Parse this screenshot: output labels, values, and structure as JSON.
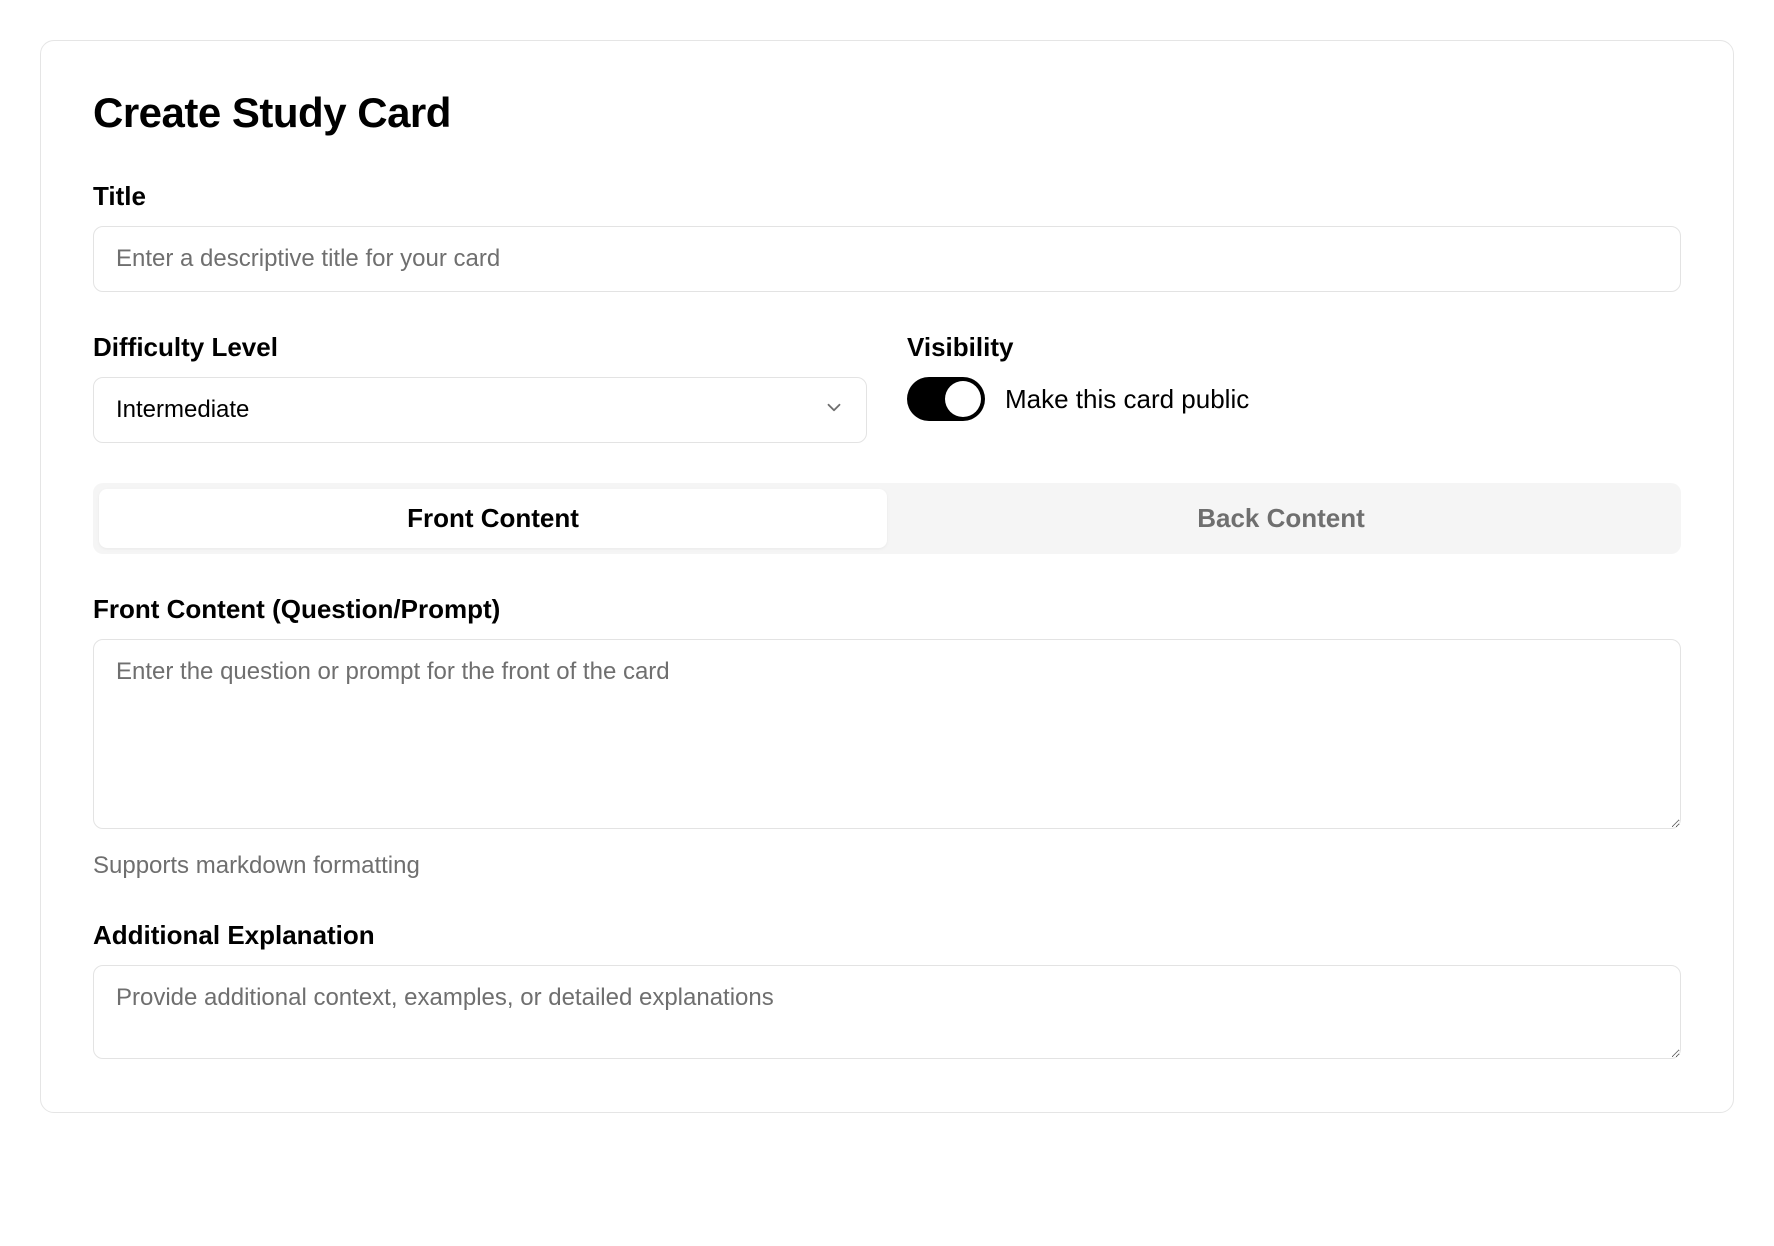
{
  "header": {
    "title": "Create Study Card"
  },
  "fields": {
    "title": {
      "label": "Title",
      "placeholder": "Enter a descriptive title for your card",
      "value": ""
    },
    "difficulty": {
      "label": "Difficulty Level",
      "selected": "Intermediate"
    },
    "visibility": {
      "label": "Visibility",
      "toggle_label": "Make this card public",
      "enabled": true
    },
    "tabs": {
      "front": "Front Content",
      "back": "Back Content",
      "active": "front"
    },
    "front_content": {
      "label": "Front Content (Question/Prompt)",
      "placeholder": "Enter the question or prompt for the front of the card",
      "value": "",
      "hint": "Supports markdown formatting"
    },
    "explanation": {
      "label": "Additional Explanation",
      "placeholder": "Provide additional context, examples, or detailed explanations",
      "value": ""
    }
  }
}
